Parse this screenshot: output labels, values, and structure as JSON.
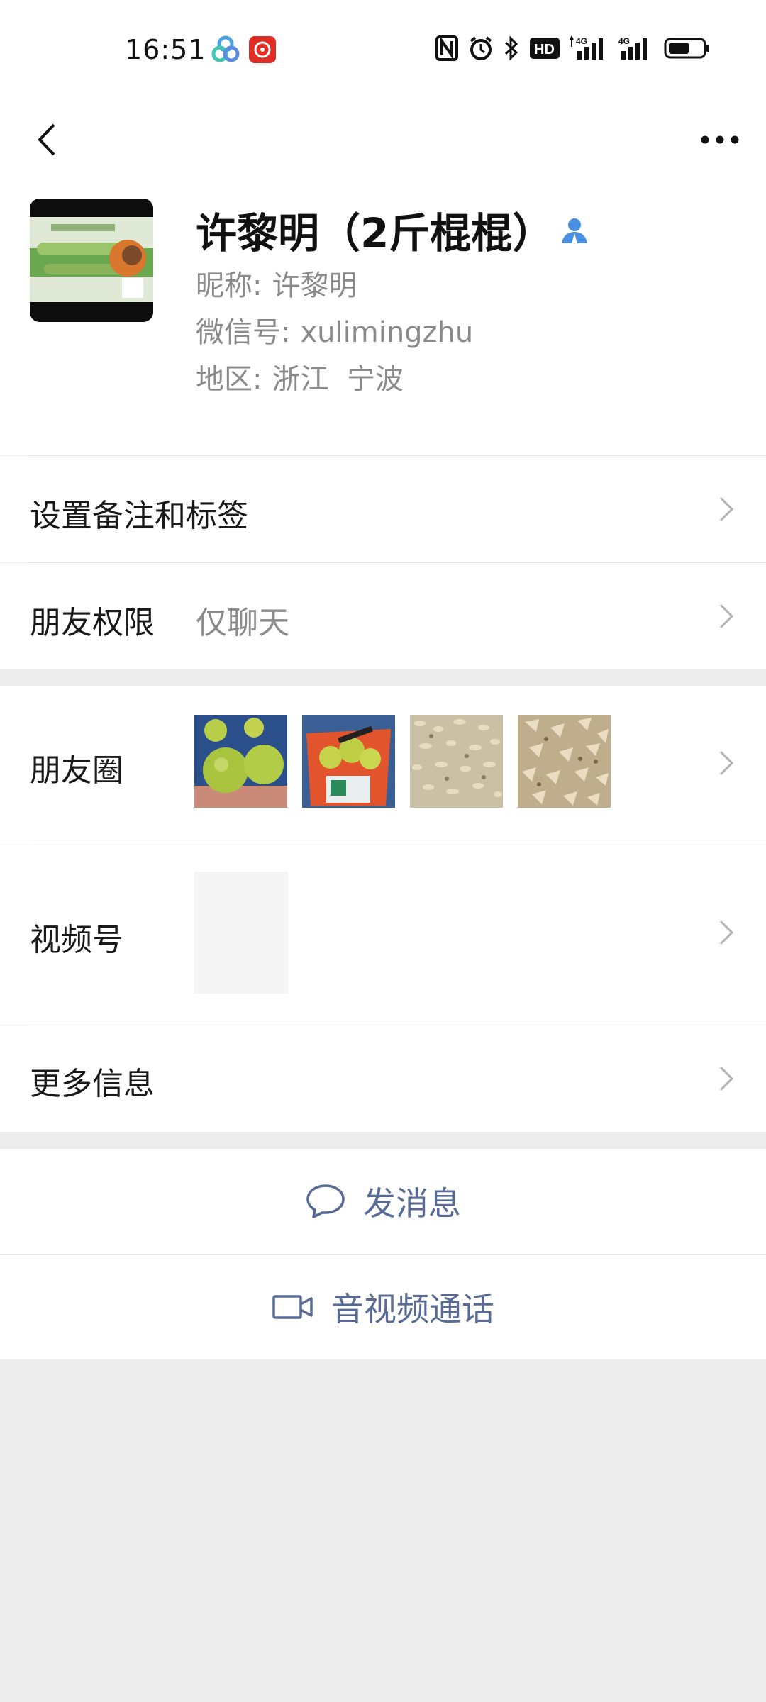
{
  "status_bar": {
    "time": "16:51",
    "network_label": "4G",
    "hd_label": "HD"
  },
  "nav": {
    "back_icon": "chevron-left-icon",
    "more_icon": "ellipsis-icon"
  },
  "profile": {
    "name": "许黎明（2斤棍棍）",
    "nickname_label": "昵称:",
    "nickname": "许黎明",
    "wechat_id_label": "微信号:",
    "wechat_id": "xulimingzhu",
    "region_label": "地区:",
    "region": "浙江  宁波"
  },
  "rows": {
    "remarks_label": "设置备注和标签",
    "permissions_label": "朋友权限",
    "permissions_value": "仅聊天",
    "moments_label": "朋友圈",
    "channels_label": "视频号",
    "more_info_label": "更多信息"
  },
  "actions": {
    "message_label": "发消息",
    "call_label": "音视频通话"
  },
  "colors": {
    "link": "#576b95",
    "verified": "#4a90e2",
    "background": "#ededed"
  }
}
